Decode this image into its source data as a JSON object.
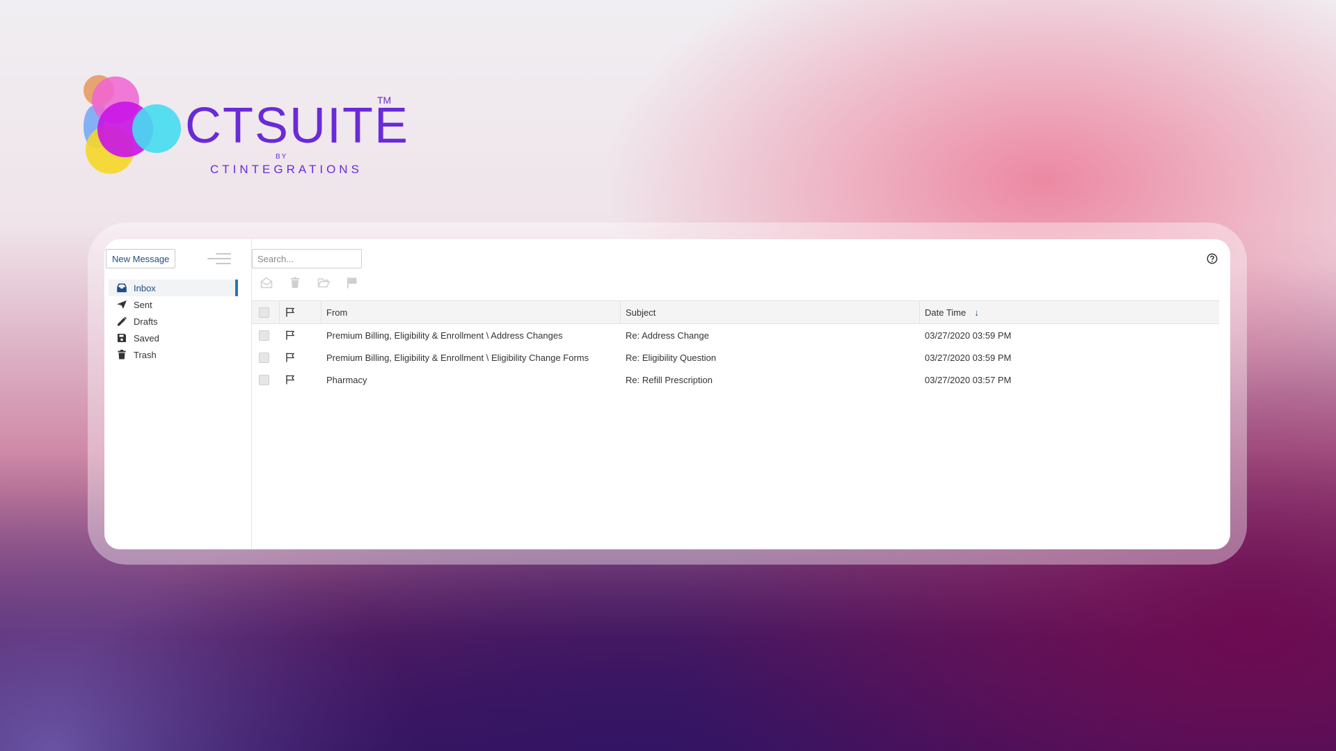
{
  "logo": {
    "brand": "CTSUITE",
    "trademark": "TM",
    "by": "BY",
    "company": "CTINTEGRATIONS"
  },
  "sidebar": {
    "new_message_label": "New Message",
    "menu_icon": "hamburger-menu-icon",
    "items": [
      {
        "label": "Inbox",
        "icon": "inbox-icon",
        "active": true
      },
      {
        "label": "Sent",
        "icon": "paper-plane-icon",
        "active": false
      },
      {
        "label": "Drafts",
        "icon": "pencil-icon",
        "active": false
      },
      {
        "label": "Saved",
        "icon": "floppy-disk-icon",
        "active": false
      },
      {
        "label": "Trash",
        "icon": "trash-icon",
        "active": false
      }
    ]
  },
  "search": {
    "placeholder": "Search...",
    "value": ""
  },
  "toolbar": {
    "icons": [
      "mark-read-icon",
      "delete-icon",
      "move-folder-icon",
      "flag-icon"
    ]
  },
  "help_icon": "help-circle-icon",
  "table": {
    "columns": {
      "from": "From",
      "subject": "Subject",
      "datetime": "Date Time"
    },
    "sort": {
      "column": "datetime",
      "direction": "descending",
      "arrow": "↓"
    },
    "rows": [
      {
        "from": "Premium Billing, Eligibility & Enrollment \\ Address Changes",
        "subject": "Re: Address Change",
        "datetime": "03/27/2020 03:59 PM"
      },
      {
        "from": "Premium Billing, Eligibility & Enrollment \\ Eligibility Change Forms",
        "subject": "Re: Eligibility Question",
        "datetime": "03/27/2020 03:59 PM"
      },
      {
        "from": "Pharmacy",
        "subject": "Re: Refill Prescription",
        "datetime": "03/27/2020 03:57 PM"
      }
    ]
  },
  "colors": {
    "brand_purple": "#6a2ad8",
    "link_blue": "#1e4e86",
    "active_indicator": "#2f72b4"
  }
}
